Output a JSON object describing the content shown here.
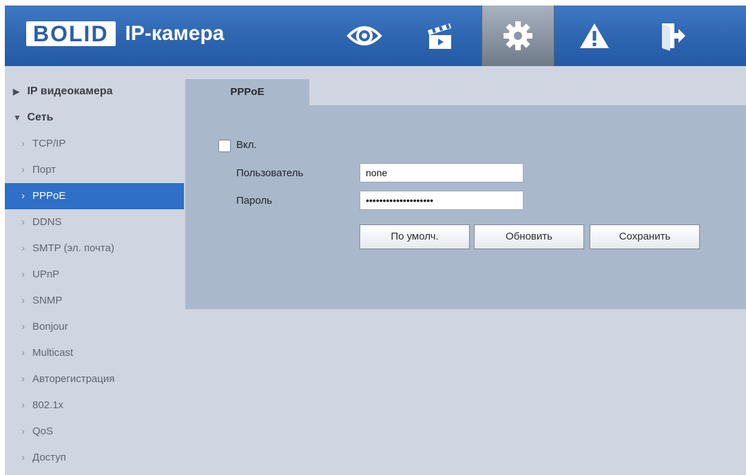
{
  "header": {
    "logo_mark": "BOLID",
    "logo_mark_display": "BOLID",
    "title": "IP-камера",
    "nav": [
      {
        "icon": "eye-icon",
        "name": "live-view"
      },
      {
        "icon": "clapperboard-icon",
        "name": "playback"
      },
      {
        "icon": "gear-icon",
        "name": "settings",
        "active": true
      },
      {
        "icon": "warning-icon",
        "name": "alarm"
      },
      {
        "icon": "logout-icon",
        "name": "logout"
      }
    ]
  },
  "sidebar": {
    "sections": [
      {
        "label": "IP видеокамера",
        "expanded": false
      },
      {
        "label": "Сеть",
        "expanded": true
      }
    ],
    "items": [
      {
        "label": "TCP/IP"
      },
      {
        "label": "Порт"
      },
      {
        "label": "PPPoE",
        "active": true
      },
      {
        "label": "DDNS"
      },
      {
        "label": "SMTP (эл. почта)"
      },
      {
        "label": "UPnP"
      },
      {
        "label": "SNMP"
      },
      {
        "label": "Bonjour"
      },
      {
        "label": "Multicast"
      },
      {
        "label": "Авторегистрация"
      },
      {
        "label": "802.1x"
      },
      {
        "label": "QoS"
      },
      {
        "label": "Доступ"
      }
    ]
  },
  "main": {
    "tab": "PPPoE",
    "enable_label": "Вкл.",
    "enable_checked": false,
    "user_label": "Пользователь",
    "user_value": "none",
    "password_label": "Пароль",
    "password_value": "••••••••••••••••••••",
    "buttons": {
      "default": "По умолч.",
      "refresh": "Обновить",
      "save": "Сохранить"
    }
  },
  "colors": {
    "header": "#2f66b1",
    "accent": "#2f6fc8",
    "panel": "#aab8cb",
    "background": "#cfd6e1"
  }
}
